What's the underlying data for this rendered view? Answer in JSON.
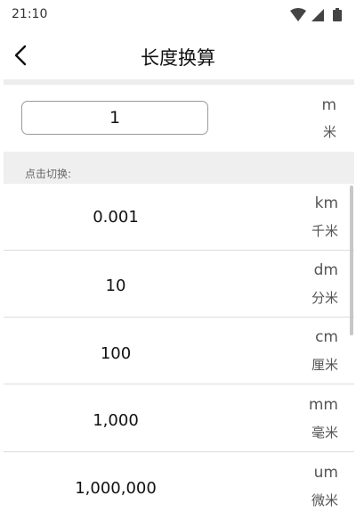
{
  "status": {
    "time": "21:10"
  },
  "header": {
    "title": "长度换算"
  },
  "input": {
    "value": "1",
    "unit_symbol": "m",
    "unit_name": "米"
  },
  "hint": "点击切换:",
  "results": [
    {
      "value": "0.001",
      "unit_symbol": "km",
      "unit_name": "千米"
    },
    {
      "value": "10",
      "unit_symbol": "dm",
      "unit_name": "分米"
    },
    {
      "value": "100",
      "unit_symbol": "cm",
      "unit_name": "厘米"
    },
    {
      "value": "1,000",
      "unit_symbol": "mm",
      "unit_name": "毫米"
    },
    {
      "value": "1,000,000",
      "unit_symbol": "um",
      "unit_name": "微米"
    }
  ],
  "icons": {
    "back": "chevron-left-icon",
    "wifi": "wifi-icon",
    "signal": "cellular-signal-icon",
    "battery": "battery-icon"
  },
  "colors": {
    "band": "#efefef",
    "divider": "#dcdcdc",
    "text": "#111111",
    "secondary_text": "#555555"
  }
}
